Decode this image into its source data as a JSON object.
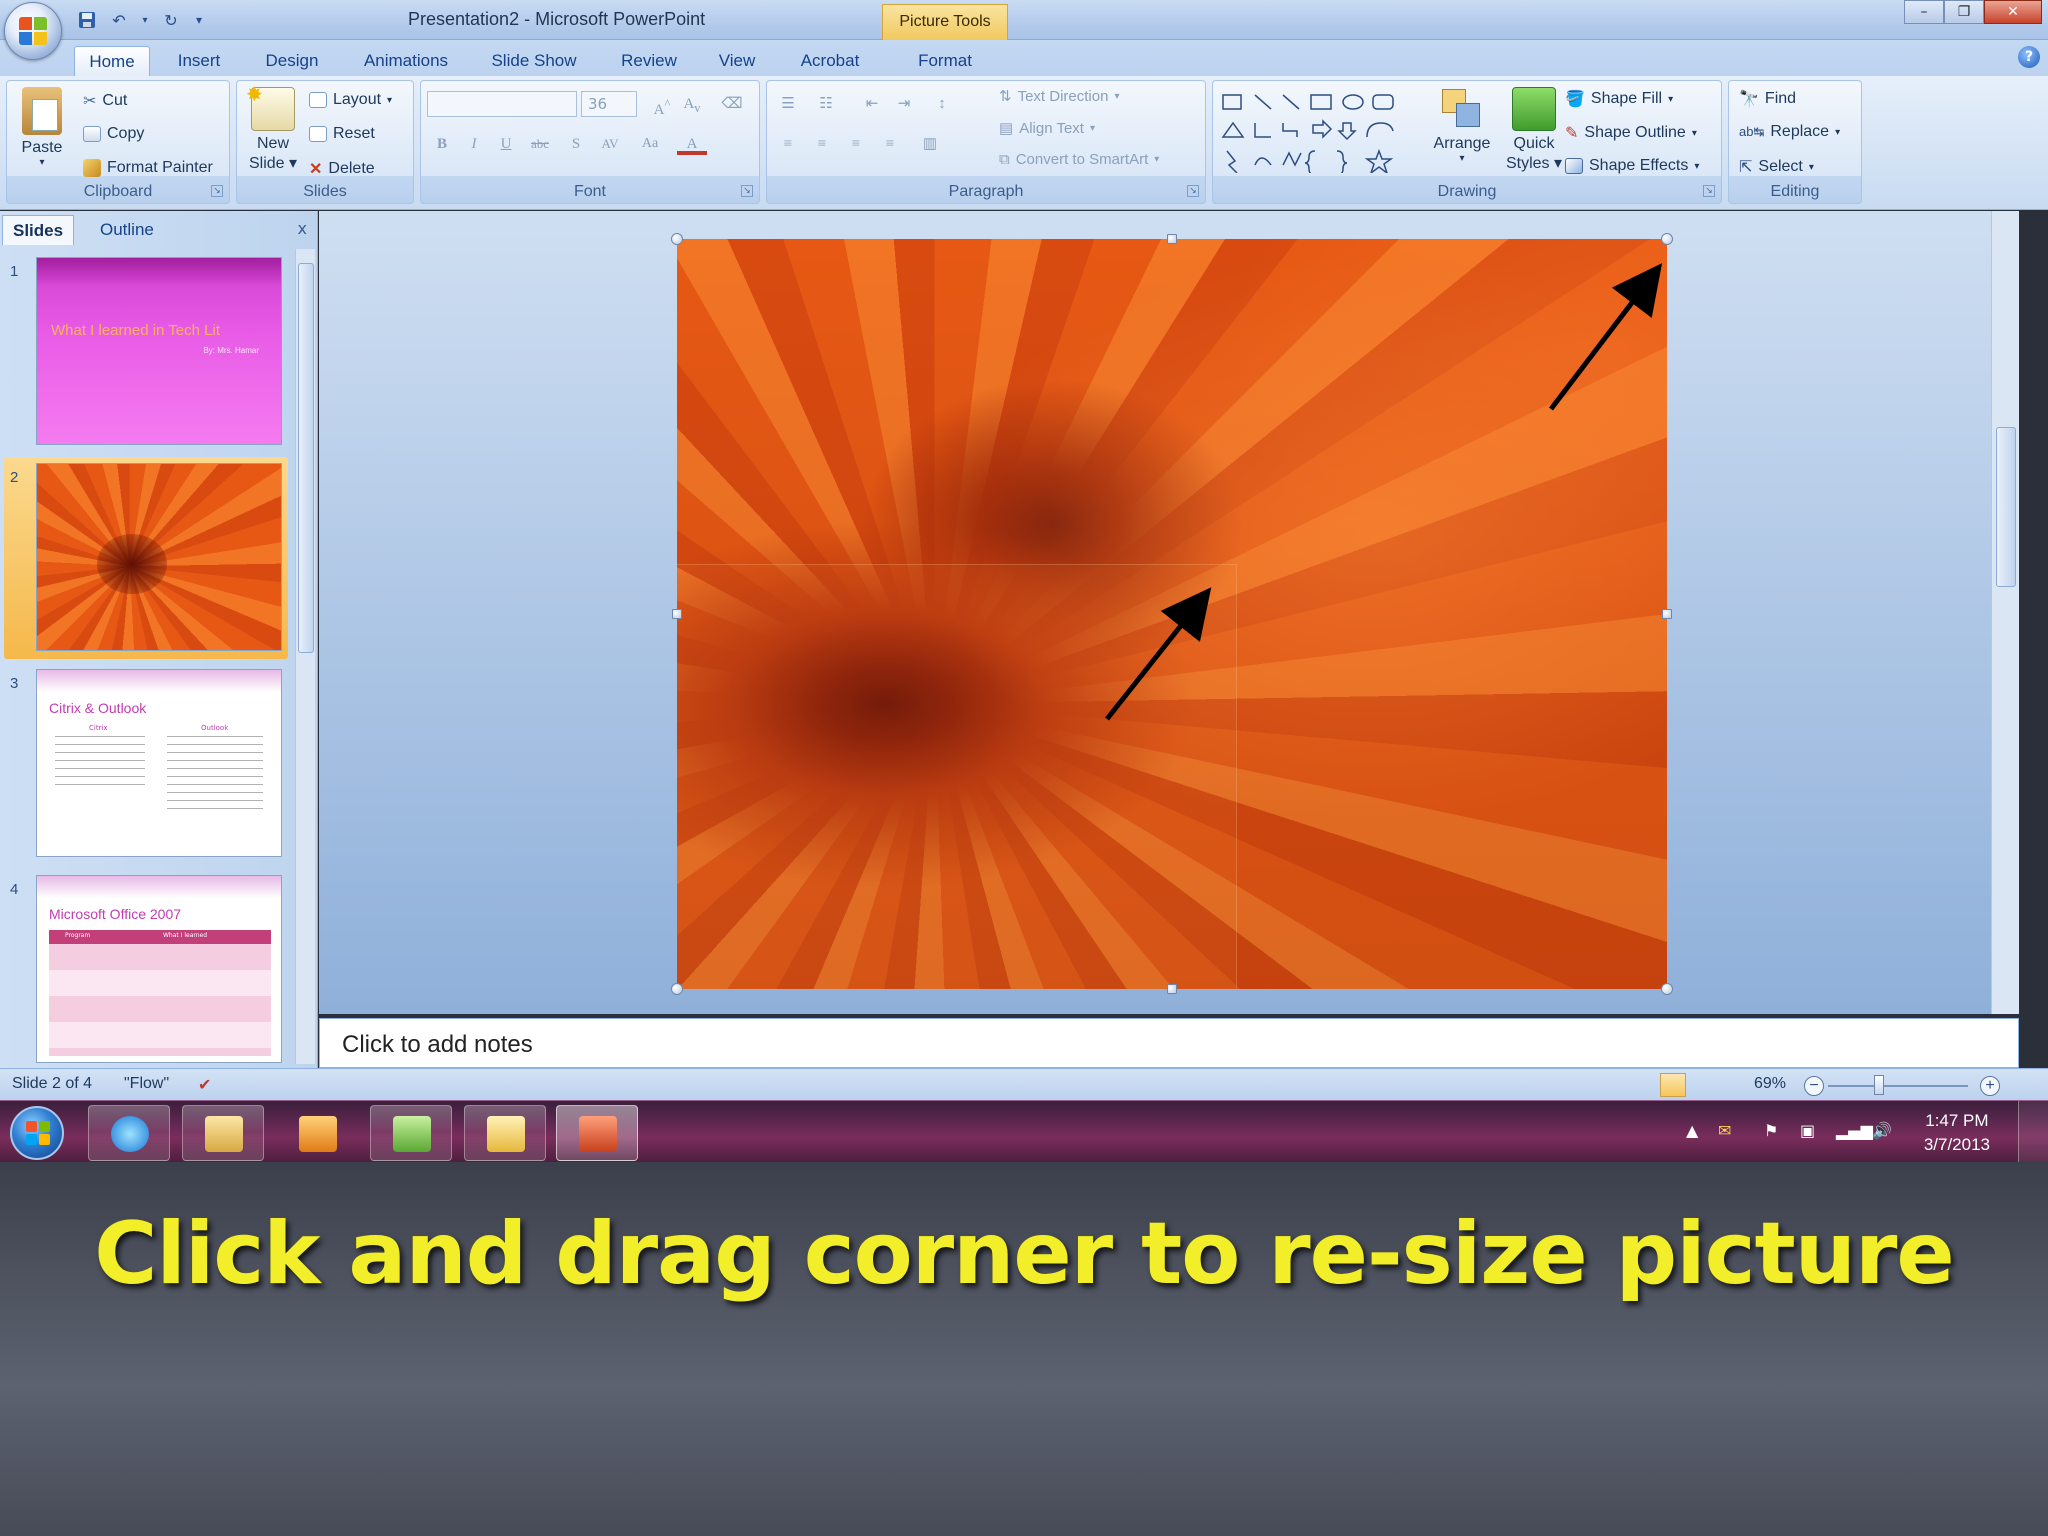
{
  "window": {
    "title": "Presentation2 - Microsoft PowerPoint",
    "context_tab": "Picture Tools",
    "controls": {
      "minimize": "–",
      "restore": "❐",
      "close": "✕"
    }
  },
  "tabs": [
    {
      "label": "Home",
      "active": true
    },
    {
      "label": "Insert"
    },
    {
      "label": "Design"
    },
    {
      "label": "Animations"
    },
    {
      "label": "Slide Show"
    },
    {
      "label": "Review"
    },
    {
      "label": "View"
    },
    {
      "label": "Acrobat"
    },
    {
      "label": "Format"
    }
  ],
  "ribbon": {
    "clipboard": {
      "label": "Clipboard",
      "paste": "Paste",
      "cut": "Cut",
      "copy": "Copy",
      "format_painter": "Format Painter"
    },
    "slides": {
      "label": "Slides",
      "new_slide_1": "New",
      "new_slide_2": "Slide",
      "layout": "Layout",
      "reset": "Reset",
      "delete": "Delete"
    },
    "font": {
      "label": "Font",
      "size": "36"
    },
    "paragraph": {
      "label": "Paragraph",
      "text_direction": "Text Direction",
      "align_text": "Align Text",
      "convert_smartart": "Convert to SmartArt"
    },
    "drawing": {
      "label": "Drawing",
      "arrange": "Arrange",
      "quick_styles_1": "Quick",
      "quick_styles_2": "Styles",
      "shape_fill": "Shape Fill",
      "shape_outline": "Shape Outline",
      "shape_effects": "Shape Effects"
    },
    "editing": {
      "label": "Editing",
      "find": "Find",
      "replace": "Replace",
      "select": "Select"
    }
  },
  "left_pane": {
    "tabs": [
      "Slides",
      "Outline"
    ],
    "close": "x",
    "slides": [
      {
        "num": "1",
        "title": "What I learned in Tech Lit",
        "subtitle": "By: Mrs. Hamar"
      },
      {
        "num": "2"
      },
      {
        "num": "3",
        "title": "Citrix & Outlook",
        "col1": "Citrix",
        "col2": "Outlook"
      },
      {
        "num": "4",
        "title": "Microsoft Office 2007",
        "col1": "Program",
        "col2": "What I learned"
      }
    ]
  },
  "notes_placeholder": "Click to add notes",
  "status": {
    "slide": "Slide 2 of 4",
    "theme": "\"Flow\"",
    "zoom": "69%"
  },
  "clock": {
    "time": "1:47 PM",
    "date": "3/7/2013"
  },
  "caption": "Click and drag corner to re-size picture",
  "colors": {
    "caption": "#f2ef2a",
    "accent": "#15428b"
  }
}
